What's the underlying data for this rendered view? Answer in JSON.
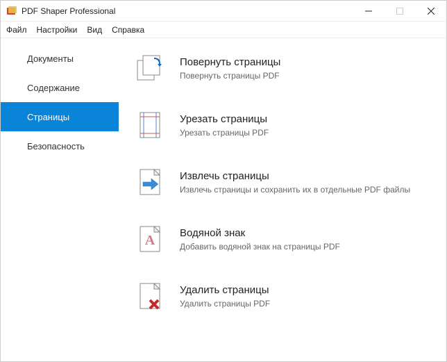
{
  "window": {
    "title": "PDF Shaper Professional"
  },
  "menu": {
    "file": "Файл",
    "settings": "Настройки",
    "view": "Вид",
    "help": "Справка"
  },
  "sidebar": {
    "items": [
      {
        "label": "Документы",
        "active": false
      },
      {
        "label": "Содержание",
        "active": false
      },
      {
        "label": "Страницы",
        "active": true
      },
      {
        "label": "Безопасность",
        "active": false
      }
    ]
  },
  "features": [
    {
      "title": "Повернуть страницы",
      "desc": "Повернуть страницы PDF",
      "icon": "rotate"
    },
    {
      "title": "Урезать страницы",
      "desc": "Урезать страницы PDF",
      "icon": "crop"
    },
    {
      "title": "Извлечь страницы",
      "desc": "Извлечь страницы и сохранить их в отдельные PDF файлы",
      "icon": "extract"
    },
    {
      "title": "Водяной знак",
      "desc": "Добавить водяной знак на страницы PDF",
      "icon": "watermark"
    },
    {
      "title": "Удалить страницы",
      "desc": "Удалить страницы PDF",
      "icon": "delete"
    }
  ]
}
